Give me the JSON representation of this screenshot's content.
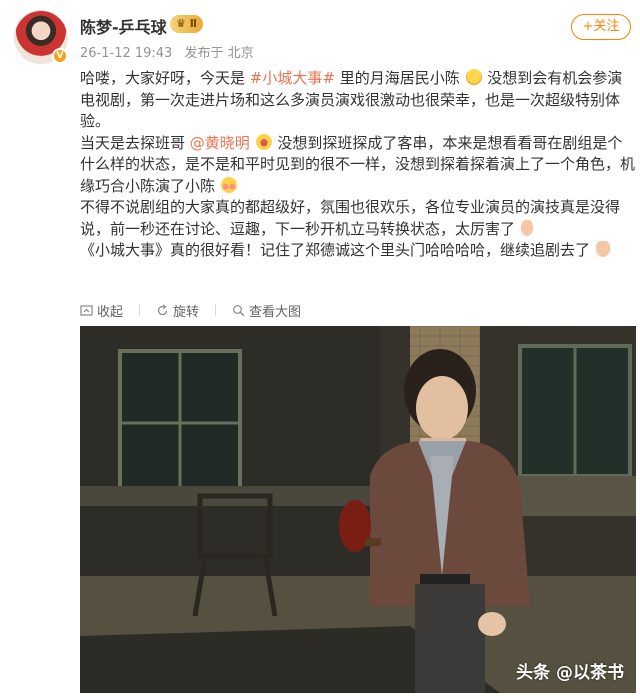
{
  "post": {
    "username": "陈梦-乒乓球",
    "vip_level": "Ⅱ",
    "timestamp": "26-1-12 19:43",
    "location": "发布于 北京",
    "follow_label": "+关注",
    "paragraphs": [
      {
        "before": "哈喽，大家好呀，今天是",
        "tag": "#小城大事#",
        "after": "里的月海居民小陈",
        "emoji": "smile-emoji",
        "tail": "没想到会有机会参演电视剧，第一次走进片场和这么多演员演戏很激动也很荣幸，也是一次超级特别体验。"
      },
      {
        "before": "当天是去探班哥",
        "mention": "@黄晓明",
        "emoji": "laugh-emoji",
        "tail": "没想到探班探成了客串，本来是想看看哥在剧组是个什么样的状态，是不是和平时见到的很不一样，没想到探着探着演上了一个角色，机缘巧合小陈演了小陈",
        "emoji2": "blush-emoji"
      },
      {
        "text": "不得不说剧组的大家真的都超级好，氛围也很欢乐，各位专业演员的演技真是没得说，前一秒还在讨论、逗趣，下一秒开机立马转换状态，太厉害了",
        "emoji": "hand-emoji"
      },
      {
        "text": "《小城大事》真的很好看！记住了郑德诚这个里头门哈哈哈哈，继续追剧去了",
        "emoji": "victory-emoji"
      }
    ]
  },
  "actions": {
    "collapse": "收起",
    "rotate": "旋转",
    "view_large": "查看大图"
  },
  "photo": {
    "watermark": "头条 @以茶书"
  }
}
